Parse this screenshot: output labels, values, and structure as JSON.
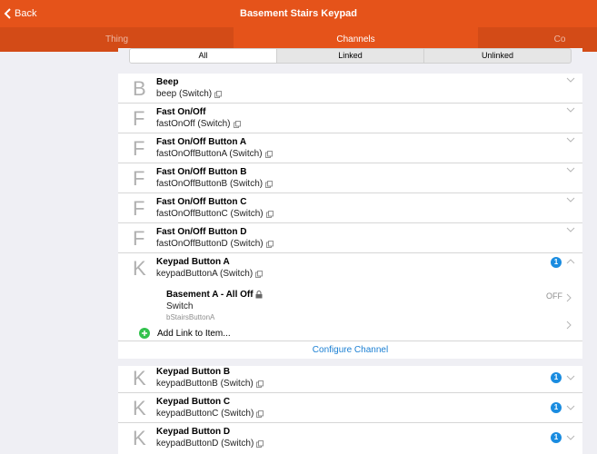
{
  "navbar": {
    "back_label": "Back",
    "title": "Basement Stairs Keypad"
  },
  "tabs": [
    {
      "label": "Thing",
      "active": false
    },
    {
      "label": "Channels",
      "active": true
    },
    {
      "label": "Co",
      "active": false
    }
  ],
  "filter": {
    "all": "All",
    "linked": "Linked",
    "unlinked": "Unlinked",
    "selected": "All"
  },
  "channels": [
    {
      "letter": "B",
      "name": "Beep",
      "id": "beep (Switch)"
    },
    {
      "letter": "F",
      "name": "Fast On/Off",
      "id": "fastOnOff (Switch)"
    },
    {
      "letter": "F",
      "name": "Fast On/Off Button A",
      "id": "fastOnOffButtonA (Switch)"
    },
    {
      "letter": "F",
      "name": "Fast On/Off Button B",
      "id": "fastOnOffButtonB (Switch)"
    },
    {
      "letter": "F",
      "name": "Fast On/Off Button C",
      "id": "fastOnOffButtonC (Switch)"
    },
    {
      "letter": "F",
      "name": "Fast On/Off Button D",
      "id": "fastOnOffButtonD (Switch)"
    },
    {
      "letter": "K",
      "name": "Keypad Button A",
      "id": "keypadButtonA (Switch)",
      "badge": "1"
    }
  ],
  "linked_item": {
    "label": "Basement A - All Off",
    "type": "Switch",
    "name": "bStairsButtonA",
    "state": "OFF"
  },
  "add_link_label": "Add Link to Item...",
  "configure_label": "Configure Channel",
  "channels_more": [
    {
      "letter": "K",
      "name": "Keypad Button B",
      "id": "keypadButtonB (Switch)",
      "badge": "1"
    },
    {
      "letter": "K",
      "name": "Keypad Button C",
      "id": "keypadButtonC (Switch)",
      "badge": "1"
    },
    {
      "letter": "K",
      "name": "Keypad Button D",
      "id": "keypadButtonD (Switch)",
      "badge": "1"
    }
  ],
  "colors": {
    "accent": "#e5531a",
    "link": "#1a7fd3",
    "badge": "#1a8ce0",
    "add": "#32c24d"
  }
}
